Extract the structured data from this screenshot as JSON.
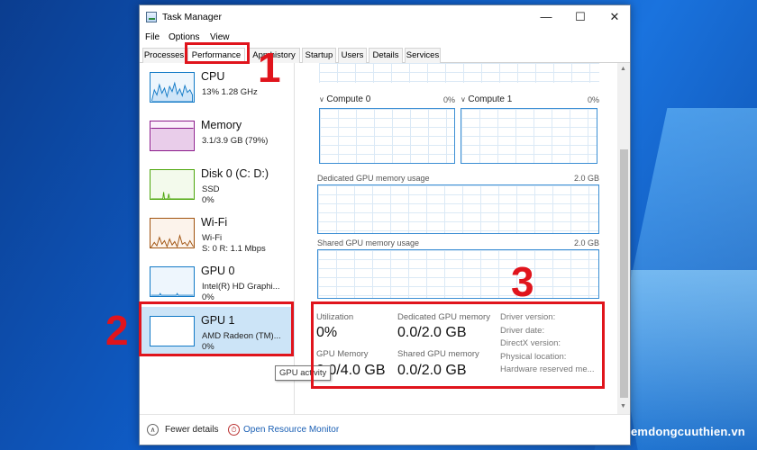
{
  "window": {
    "title": "Task Manager"
  },
  "menu": [
    "File",
    "Options",
    "View"
  ],
  "tabs": [
    "Processes",
    "Performance",
    "App history",
    "Startup",
    "Users",
    "Details",
    "Services"
  ],
  "resources": [
    {
      "name": "CPU",
      "line1": "13% 1.28 GHz",
      "line2": ""
    },
    {
      "name": "Memory",
      "line1": "3.1/3.9 GB (79%)",
      "line2": ""
    },
    {
      "name": "Disk 0 (C: D:)",
      "line1": "SSD",
      "line2": "0%"
    },
    {
      "name": "Wi-Fi",
      "line1": "Wi-Fi",
      "line2": "S: 0 R: 1.1 Mbps"
    },
    {
      "name": "GPU 0",
      "line1": "Intel(R) HD Graphi...",
      "line2": "0%"
    },
    {
      "name": "GPU 1",
      "line1": "AMD Radeon (TM)...",
      "line2": "0%"
    }
  ],
  "graphs": {
    "compute0": {
      "label": "Compute 0",
      "max": "0%"
    },
    "compute1": {
      "label": "Compute 1",
      "max": "0%"
    },
    "dedicated": {
      "label": "Dedicated GPU memory usage",
      "max": "2.0 GB"
    },
    "shared": {
      "label": "Shared GPU memory usage",
      "max": "2.0 GB"
    }
  },
  "stats": {
    "utilization": {
      "label": "Utilization",
      "value": "0%"
    },
    "dedicated": {
      "label": "Dedicated GPU memory",
      "value": "0.0/2.0 GB"
    },
    "gpu_memory": {
      "label": "GPU Memory",
      "value": "0.0/4.0 GB"
    },
    "shared": {
      "label": "Shared GPU memory",
      "value": "0.0/2.0 GB"
    }
  },
  "info": [
    "Driver version:",
    "Driver date:",
    "DirectX version:",
    "Physical location:",
    "Hardware reserved me..."
  ],
  "tooltip": "GPU activity",
  "footer": {
    "fewer": "Fewer details",
    "monitor": "Open Resource Monitor"
  },
  "annotations": [
    "1",
    "2",
    "3"
  ],
  "watermark": "emdongcuuthien.vn",
  "colors": {
    "cpu": "#1179c6",
    "memory": "#8b1a8b",
    "disk": "#4da60c",
    "wifi": "#a0520e",
    "gpu": "#1179c6",
    "selected": "#cce4f7",
    "annotation": "#e0141c"
  }
}
